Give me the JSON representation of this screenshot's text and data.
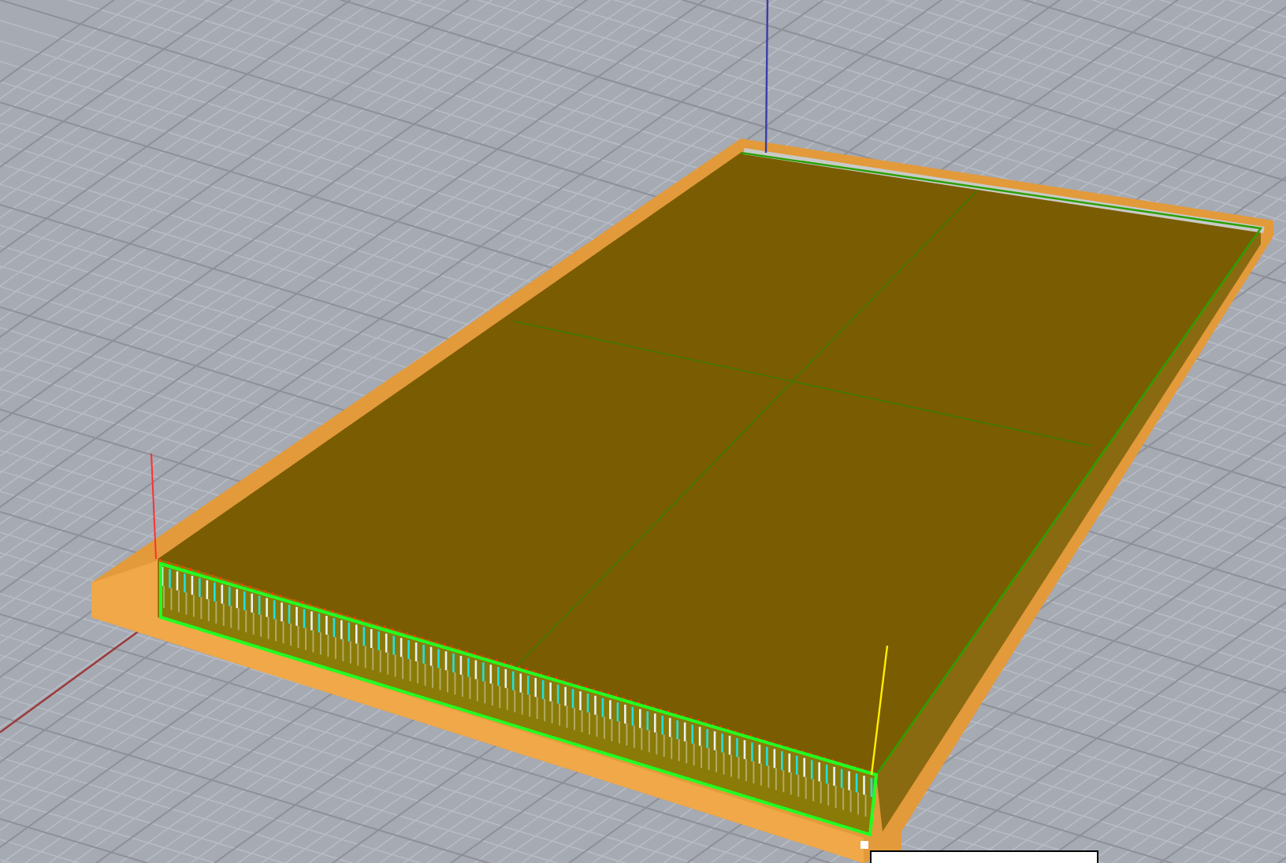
{
  "viewport": {
    "tooltip": {
      "shown": true
    }
  }
}
